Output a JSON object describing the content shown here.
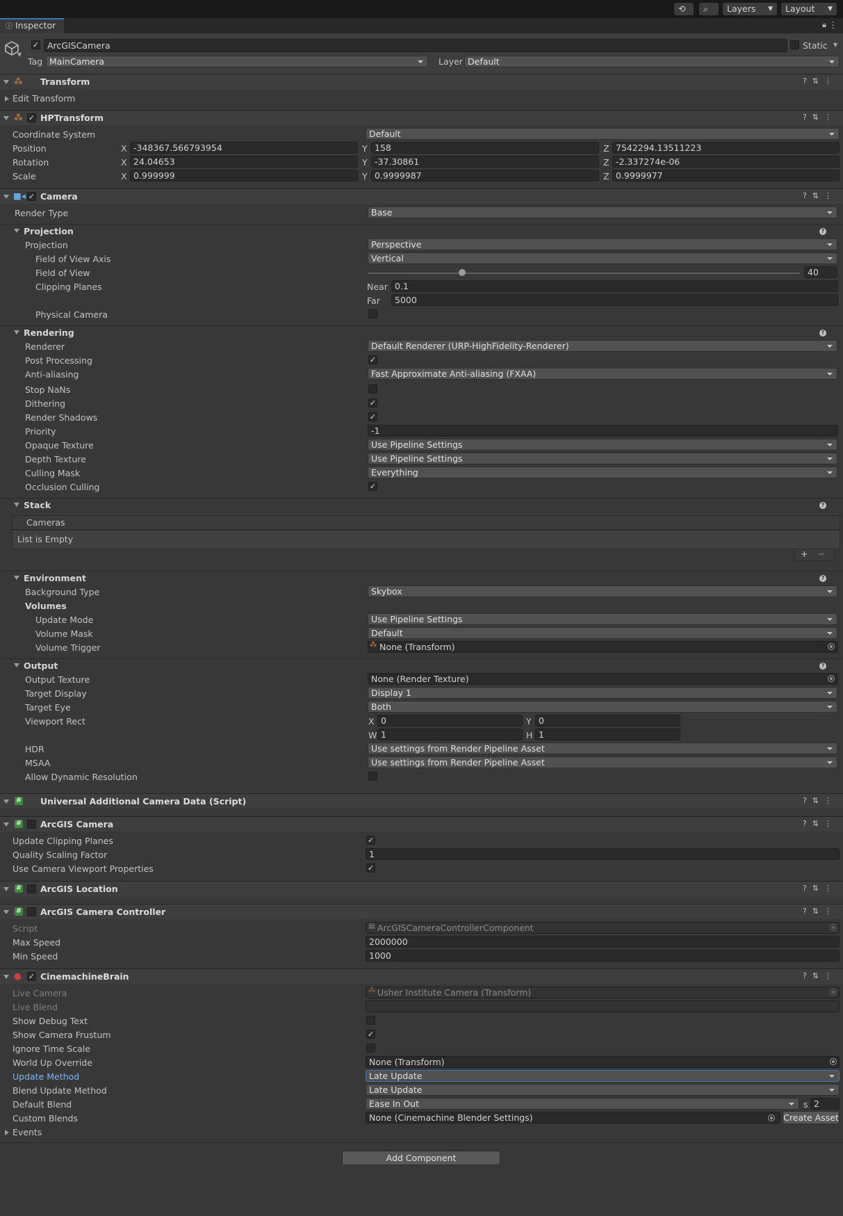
{
  "toolbar": {
    "layers": "Layers",
    "layout": "Layout"
  },
  "tab": {
    "label": "Inspector"
  },
  "object": {
    "name": "ArcGISCamera",
    "static_label": "Static",
    "tag_label": "Tag",
    "tag_value": "MainCamera",
    "layer_label": "Layer",
    "layer_value": "Default"
  },
  "transform": {
    "title": "Transform",
    "edit": "Edit Transform"
  },
  "hptransform": {
    "title": "HPTransform",
    "coord_label": "Coordinate System",
    "coord_value": "Default",
    "pos_label": "Position",
    "pos_x": "-348367.566793954",
    "pos_y": "158",
    "pos_z": "7542294.13511223",
    "rot_label": "Rotation",
    "rot_x": "24.04653",
    "rot_y": "-37.30861",
    "rot_z": "-2.337274e-06",
    "scale_label": "Scale",
    "scale_x": "0.999999",
    "scale_y": "0.9999987",
    "scale_z": "0.9999977",
    "x": "X",
    "y": "Y",
    "z": "Z"
  },
  "camera": {
    "title": "Camera",
    "render_type_label": "Render Type",
    "render_type": "Base",
    "projection_section": "Projection",
    "projection_label": "Projection",
    "projection": "Perspective",
    "fov_axis_label": "Field of View Axis",
    "fov_axis": "Vertical",
    "fov_label": "Field of View",
    "fov": "40",
    "clipping_label": "Clipping Planes",
    "near_label": "Near",
    "near": "0.1",
    "far_label": "Far",
    "far": "5000",
    "physical_label": "Physical Camera",
    "rendering_section": "Rendering",
    "renderer_label": "Renderer",
    "renderer": "Default Renderer (URP-HighFidelity-Renderer)",
    "postproc_label": "Post Processing",
    "aa_label": "Anti-aliasing",
    "aa": "Fast Approximate Anti-aliasing (FXAA)",
    "stopnans_label": "Stop NaNs",
    "dither_label": "Dithering",
    "shadows_label": "Render Shadows",
    "priority_label": "Priority",
    "priority": "-1",
    "opaque_label": "Opaque Texture",
    "opaque": "Use Pipeline Settings",
    "depth_label": "Depth Texture",
    "depth": "Use Pipeline Settings",
    "culling_label": "Culling Mask",
    "culling": "Everything",
    "occlusion_label": "Occlusion Culling",
    "stack_section": "Stack",
    "cameras_label": "Cameras",
    "list_empty": "List is Empty",
    "env_section": "Environment",
    "bg_label": "Background Type",
    "bg": "Skybox",
    "volumes_label": "Volumes",
    "update_mode_label": "Update Mode",
    "update_mode": "Use Pipeline Settings",
    "volume_mask_label": "Volume Mask",
    "volume_mask": "Default",
    "volume_trigger_label": "Volume Trigger",
    "volume_trigger": "None (Transform)",
    "output_section": "Output",
    "out_tex_label": "Output Texture",
    "out_tex": "None (Render Texture)",
    "target_display_label": "Target Display",
    "target_display": "Display 1",
    "target_eye_label": "Target Eye",
    "target_eye": "Both",
    "viewport_label": "Viewport Rect",
    "vp_x_label": "X",
    "vp_x": "0",
    "vp_y_label": "Y",
    "vp_y": "0",
    "vp_w_label": "W",
    "vp_w": "1",
    "vp_h_label": "H",
    "vp_h": "1",
    "hdr_label": "HDR",
    "hdr": "Use settings from Render Pipeline Asset",
    "msaa_label": "MSAA",
    "msaa": "Use settings from Render Pipeline Asset",
    "dynres_label": "Allow Dynamic Resolution"
  },
  "uacd": {
    "title": "Universal Additional Camera Data (Script)"
  },
  "arcgis_camera": {
    "title": "ArcGIS Camera",
    "update_clip_label": "Update Clipping Planes",
    "quality_label": "Quality Scaling Factor",
    "quality": "1",
    "use_viewport_label": "Use Camera Viewport Properties"
  },
  "arcgis_location": {
    "title": "ArcGIS Location"
  },
  "arcgis_controller": {
    "title": "ArcGIS Camera Controller",
    "script_label": "Script",
    "script": "ArcGISCameraControllerComponent",
    "max_label": "Max Speed",
    "max": "2000000",
    "min_label": "Min Speed",
    "min": "1000"
  },
  "cine": {
    "title": "CinemachineBrain",
    "live_cam_label": "Live Camera",
    "live_cam": "Usher Institute Camera (Transform)",
    "live_blend_label": "Live Blend",
    "debug_label": "Show Debug Text",
    "frustum_label": "Show Camera Frustum",
    "ignore_label": "Ignore Time Scale",
    "worldup_label": "World Up Override",
    "worldup": "None (Transform)",
    "update_label": "Update Method",
    "update": "Late Update",
    "blend_update_label": "Blend Update Method",
    "blend_update": "Late Update",
    "default_blend_label": "Default Blend",
    "default_blend": "Ease In Out",
    "s_label": "s",
    "s": "2",
    "custom_label": "Custom Blends",
    "custom": "None (Cinemachine Blender Settings)",
    "create_asset": "Create Asset",
    "events_label": "Events"
  },
  "add_component": "Add Component",
  "colors": {
    "accent": "#3a79bb",
    "panel": "#383838",
    "header": "#3e3e3e"
  }
}
